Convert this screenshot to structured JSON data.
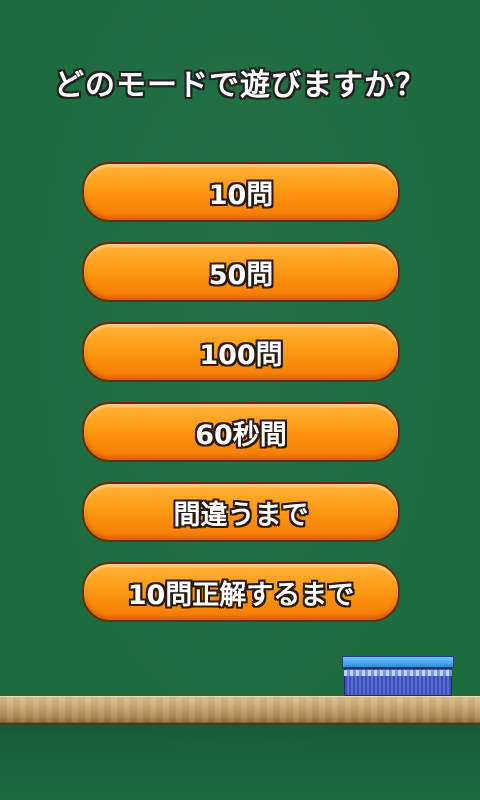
{
  "screen": {
    "title": "どのモードで遊びますか？"
  },
  "modes": [
    {
      "label": "10問"
    },
    {
      "label": "50問"
    },
    {
      "label": "100問"
    },
    {
      "label": "60秒間"
    },
    {
      "label": "間違うまで"
    },
    {
      "label": "10問正解するまで"
    }
  ],
  "colors": {
    "board": "#1c6b3f",
    "button": "#ff9a14",
    "button_border": "#6b2a00",
    "text": "#ffffff"
  },
  "decor": {
    "eraser": "blackboard-eraser-icon",
    "chalk_ledge": "chalk-tray"
  }
}
